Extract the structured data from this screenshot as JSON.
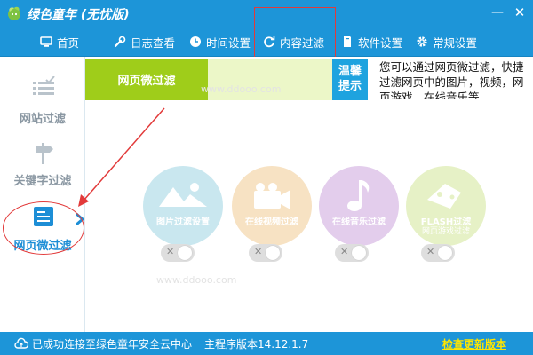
{
  "app": {
    "title": "绿色童年 (无忧版)",
    "min_glyph": "—",
    "close_glyph": "✕"
  },
  "nav": {
    "items": [
      {
        "label": "首页",
        "icon": "monitor-icon"
      },
      {
        "label": "日志查看",
        "icon": "wrench-icon"
      },
      {
        "label": "时间设置",
        "icon": "clock-icon"
      },
      {
        "label": "内容过滤",
        "icon": "refresh-icon",
        "active": true
      },
      {
        "label": "软件设置",
        "icon": "book-icon"
      },
      {
        "label": "常规设置",
        "icon": "gear-icon"
      }
    ]
  },
  "sidebar": {
    "items": [
      {
        "label": "网站过滤",
        "icon": "list-check-icon"
      },
      {
        "label": "关键字过滤",
        "icon": "signpost-icon"
      },
      {
        "label": "网页微过滤",
        "icon": "webpage-icon",
        "active": true
      }
    ]
  },
  "content": {
    "sub_tab": "网页微过滤",
    "tip_tag": [
      "温馨",
      "提示"
    ],
    "tip_text": "您可以通过网页微过滤，快捷过滤网页中的图片，视频，网页游戏，在线音乐等",
    "features": [
      {
        "label": "图片过滤设置",
        "icon": "picture-icon",
        "enabled": false
      },
      {
        "label": "在线视频过滤",
        "icon": "video-camera-icon",
        "enabled": false
      },
      {
        "label": "在线音乐过滤",
        "icon": "music-note-icon",
        "enabled": false
      },
      {
        "label": "FLASH过滤",
        "sublabel": "网页游戏过滤",
        "icon": "gamepad-icon",
        "enabled": false
      }
    ],
    "toggle_glyph": "✕"
  },
  "status": {
    "connection": "已成功连接至绿色童年安全云中心",
    "version": "主程序版本14.12.1.7",
    "update": "检查更新版本"
  },
  "colors": {
    "primary": "#1d95d8",
    "accent_green": "#9fcd1a",
    "annotation_red": "#e23a3a",
    "update_link": "#ffe600"
  }
}
